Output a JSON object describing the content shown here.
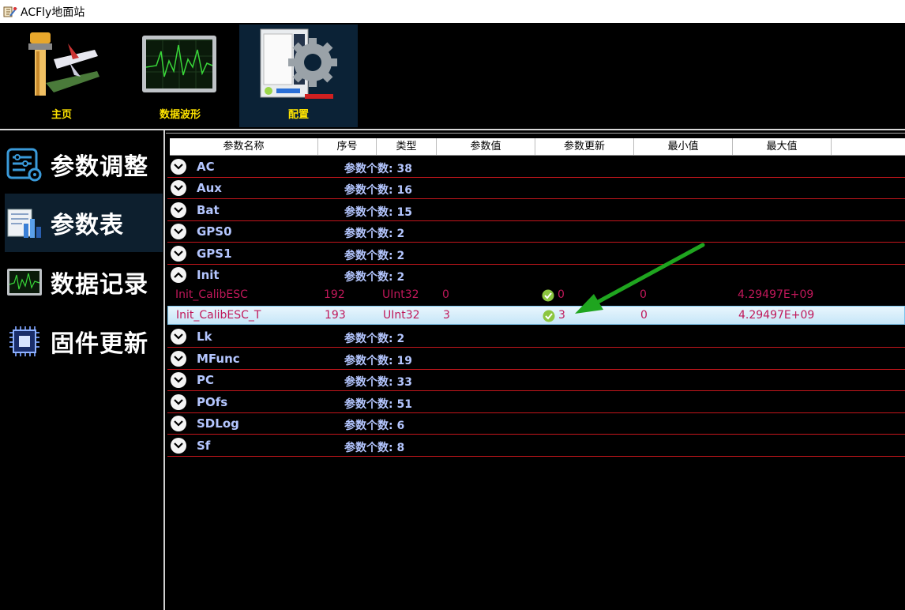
{
  "window": {
    "title": "ACFly地面站"
  },
  "toolbar": {
    "items": [
      {
        "label": "主页",
        "icon": "airport-tower-icon",
        "active": false
      },
      {
        "label": "数据波形",
        "icon": "waveform-monitor-icon",
        "active": false
      },
      {
        "label": "配置",
        "icon": "config-gear-icon",
        "active": true
      }
    ]
  },
  "sidebar": {
    "items": [
      {
        "label": "参数调整",
        "icon": "parameter-adjust-icon",
        "active": false
      },
      {
        "label": "参数表",
        "icon": "parameter-table-icon",
        "active": true
      },
      {
        "label": "数据记录",
        "icon": "data-log-icon",
        "active": false
      },
      {
        "label": "固件更新",
        "icon": "firmware-chip-icon",
        "active": false
      }
    ]
  },
  "table": {
    "columns": [
      "参数名称",
      "序号",
      "类型",
      "参数值",
      "参数更新",
      "最小值",
      "最大值"
    ],
    "count_label": "参数个数:",
    "groups": [
      {
        "name": "AC",
        "count": "38",
        "expanded": false
      },
      {
        "name": "Aux",
        "count": "16",
        "expanded": false
      },
      {
        "name": "Bat",
        "count": "15",
        "expanded": false
      },
      {
        "name": "GPS0",
        "count": "2",
        "expanded": false
      },
      {
        "name": "GPS1",
        "count": "2",
        "expanded": false
      },
      {
        "name": "Init",
        "count": "2",
        "expanded": true
      },
      {
        "name": "Lk",
        "count": "2",
        "expanded": false
      },
      {
        "name": "MFunc",
        "count": "19",
        "expanded": false
      },
      {
        "name": "PC",
        "count": "33",
        "expanded": false
      },
      {
        "name": "POfs",
        "count": "51",
        "expanded": false
      },
      {
        "name": "SDLog",
        "count": "6",
        "expanded": false
      },
      {
        "name": "Sf",
        "count": "8",
        "expanded": false
      }
    ],
    "init_rows": [
      {
        "name": "Init_CalibESC",
        "index": "192",
        "type": "UInt32",
        "value": "0",
        "update": "0",
        "min": "0",
        "max": "4.29497E+09",
        "selected": false
      },
      {
        "name": "Init_CalibESC_T",
        "index": "193",
        "type": "UInt32",
        "value": "3",
        "update": "3",
        "min": "0",
        "max": "4.29497E+09",
        "selected": true
      }
    ]
  },
  "colors": {
    "accent_yellow": "#ffe400",
    "group_text": "#b4c6ff",
    "param_text": "#c0185a",
    "row_border": "#c4161c",
    "arrow": "#1fa51f"
  }
}
